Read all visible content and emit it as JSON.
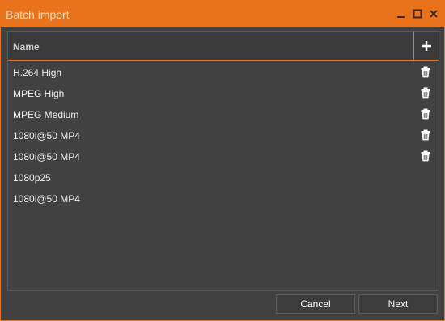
{
  "window": {
    "title": "Batch import"
  },
  "table": {
    "header_name": "Name",
    "rows": [
      {
        "label": "H.264 High",
        "deletable": true
      },
      {
        "label": "MPEG High",
        "deletable": true
      },
      {
        "label": "MPEG Medium",
        "deletable": true
      },
      {
        "label": "1080i@50 MP4",
        "deletable": true
      },
      {
        "label": "1080i@50 MP4",
        "deletable": true
      },
      {
        "label": "1080p25",
        "deletable": false
      },
      {
        "label": "1080i@50 MP4",
        "deletable": false
      }
    ]
  },
  "footer": {
    "cancel_label": "Cancel",
    "next_label": "Next"
  },
  "colors": {
    "accent": "#e8731c",
    "background": "#414141",
    "text": "#f0f0f0"
  },
  "icons": {
    "add": "plus-icon",
    "delete": "trash-icon",
    "minimize": "minimize-icon",
    "maximize": "maximize-icon",
    "close": "close-icon"
  }
}
